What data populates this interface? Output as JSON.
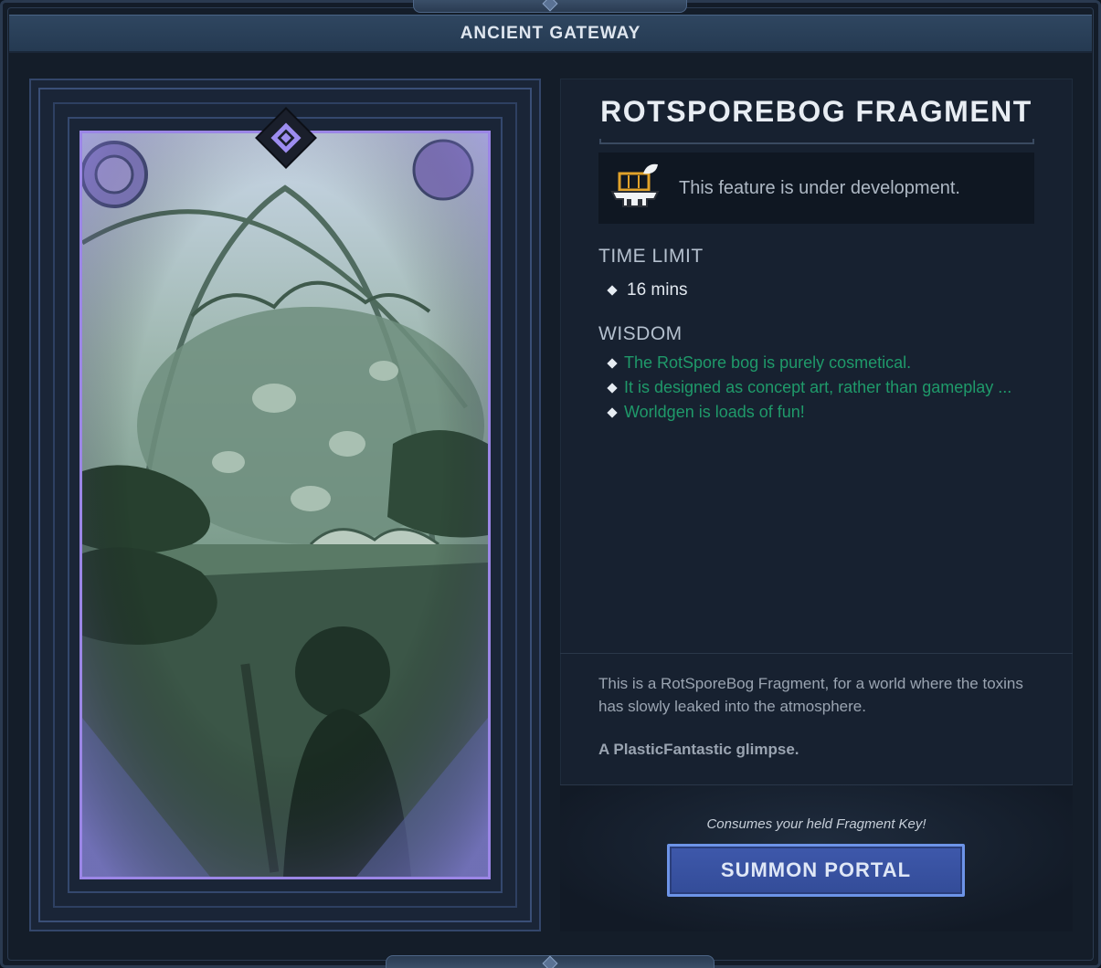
{
  "window": {
    "title": "ANCIENT GATEWAY"
  },
  "card": {
    "art_name": "RotSporeBog concept art",
    "emblem_icon": "gateway-emblem-icon"
  },
  "info": {
    "title": "ROTSPOREBOG FRAGMENT",
    "notice": {
      "icon": "construction-icon",
      "text": "This feature is under development."
    },
    "time_limit": {
      "heading": "TIME LIMIT",
      "items": [
        "16 mins"
      ]
    },
    "wisdom": {
      "heading": "WISDOM",
      "items": [
        "The RotSpore bog is purely cosmetical.",
        "It is designed as concept art, rather than gameplay ...",
        "Worldgen is loads of fun!"
      ]
    },
    "description": "This is a RotSporeBog Fragment, for a world where the toxins has slowly leaked into the atmosphere.",
    "description_bold": "A PlasticFantastic glimpse.",
    "consume_note": "Consumes your held Fragment Key!",
    "summon_label": "SUMMON PORTAL"
  },
  "colors": {
    "accent": "#6d94e8",
    "wisdom_text": "#1f9a6a",
    "card_border": "#9b86e6"
  }
}
